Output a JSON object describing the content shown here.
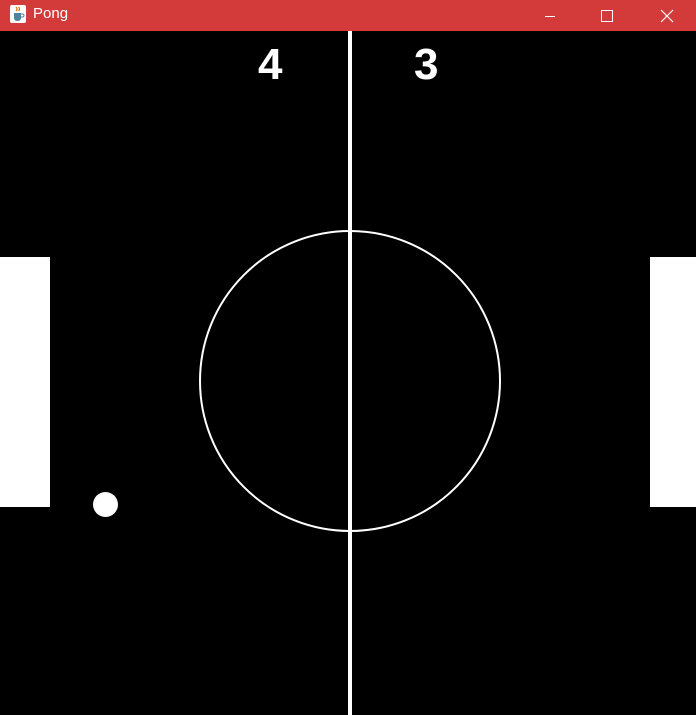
{
  "window": {
    "title": "Pong",
    "titlebar_color": "#d33b3b",
    "icon": "java-cup-icon",
    "controls": [
      "minimize-icon",
      "maximize-icon",
      "close-icon"
    ]
  },
  "game": {
    "background_color": "#000000",
    "foreground_color": "#ffffff",
    "score_left": "4",
    "score_right": "3"
  }
}
